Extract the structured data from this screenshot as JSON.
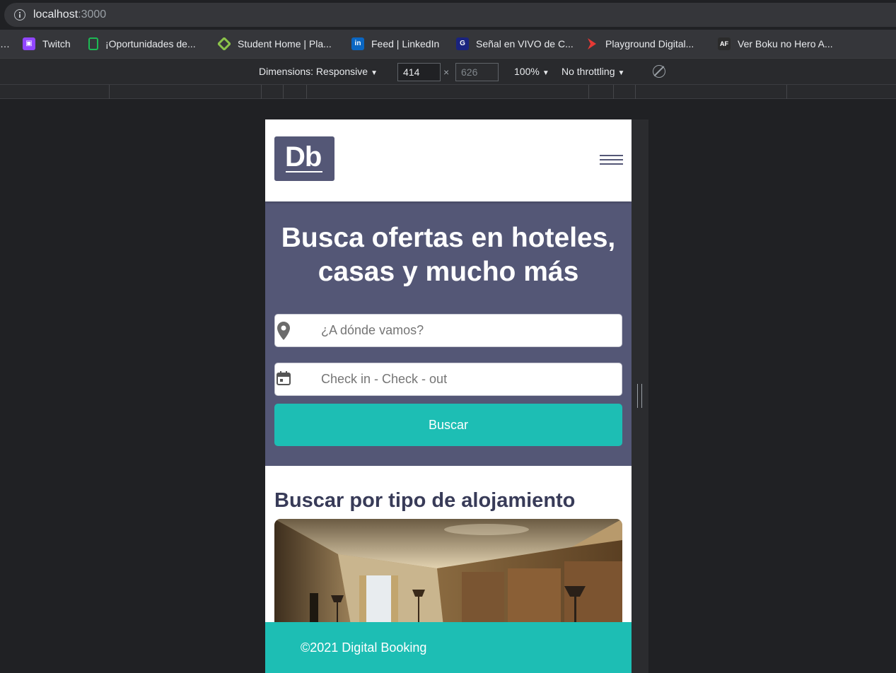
{
  "browser": {
    "url_host": "localhost",
    "url_port": ":3000",
    "bookmarks": [
      {
        "label": "…",
        "icon": "ellipsis"
      },
      {
        "label": "Twitch",
        "icon": "twitch-icon",
        "color": "#9146ff"
      },
      {
        "label": "¡Oportunidades de...",
        "icon": "bookmark-page-icon",
        "color": "#1db954"
      },
      {
        "label": "Student Home | Pla...",
        "icon": "diamond-logo-icon",
        "color": "#8bc34a"
      },
      {
        "label": "Feed | LinkedIn",
        "icon": "linkedin-icon",
        "color": "#0a66c2"
      },
      {
        "label": "Señal en VIVO de C...",
        "icon": "tv-channel-icon",
        "color": "#1a237e"
      },
      {
        "label": "Playground Digital...",
        "icon": "play-arrow-icon",
        "color": "#e53935"
      },
      {
        "label": "Ver Boku no Hero A...",
        "icon": "af-logo-icon",
        "color": "#2b2b2b"
      }
    ]
  },
  "devtools": {
    "dimensions_label": "Dimensions: Responsive",
    "width": "414",
    "height": "626",
    "times": "×",
    "zoom": "100%",
    "throttling": "No throttling"
  },
  "page": {
    "colors": {
      "primary": "#545776",
      "accent": "#1dbeb4",
      "title": "#383b58"
    },
    "logo_text": "Db",
    "hero_title_line1": "Busca ofertas en hoteles,",
    "hero_title_line2": "casas y mucho más",
    "destination_placeholder": "¿A dónde vamos?",
    "dates_placeholder": "Check in - Check - out",
    "search_button": "Buscar",
    "section_title": "Buscar por tipo de alojamiento",
    "footer": "©2021 Digital Booking"
  }
}
